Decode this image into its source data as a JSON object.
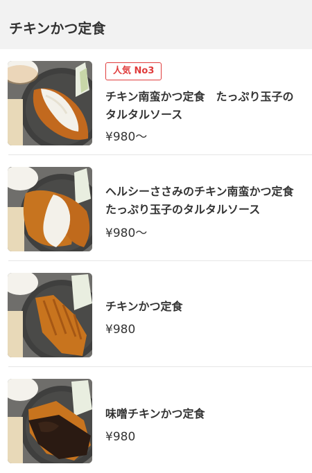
{
  "header": {
    "title": "チキンかつ定食"
  },
  "items": [
    {
      "badge": "人気 No3",
      "name": "チキン南蛮かつ定食　たっぷり玉子のタルタルソース",
      "price": "¥980〜",
      "image_icon": "chicken-nanban-photo"
    },
    {
      "name": "ヘルシーささみのチキン南蛮かつ定食　たっぷり玉子のタルタルソース",
      "price": "¥980〜",
      "image_icon": "sasami-nanban-photo"
    },
    {
      "name": "チキンかつ定食",
      "price": "¥980",
      "image_icon": "chicken-katsu-photo"
    },
    {
      "name": "味噌チキンかつ定食",
      "price": "¥980",
      "image_icon": "miso-chicken-katsu-photo"
    }
  ],
  "colors": {
    "header_bg": "#f2f2f2",
    "badge_red": "#e03b3b",
    "text": "#333333",
    "divider": "#e6e6e6"
  }
}
